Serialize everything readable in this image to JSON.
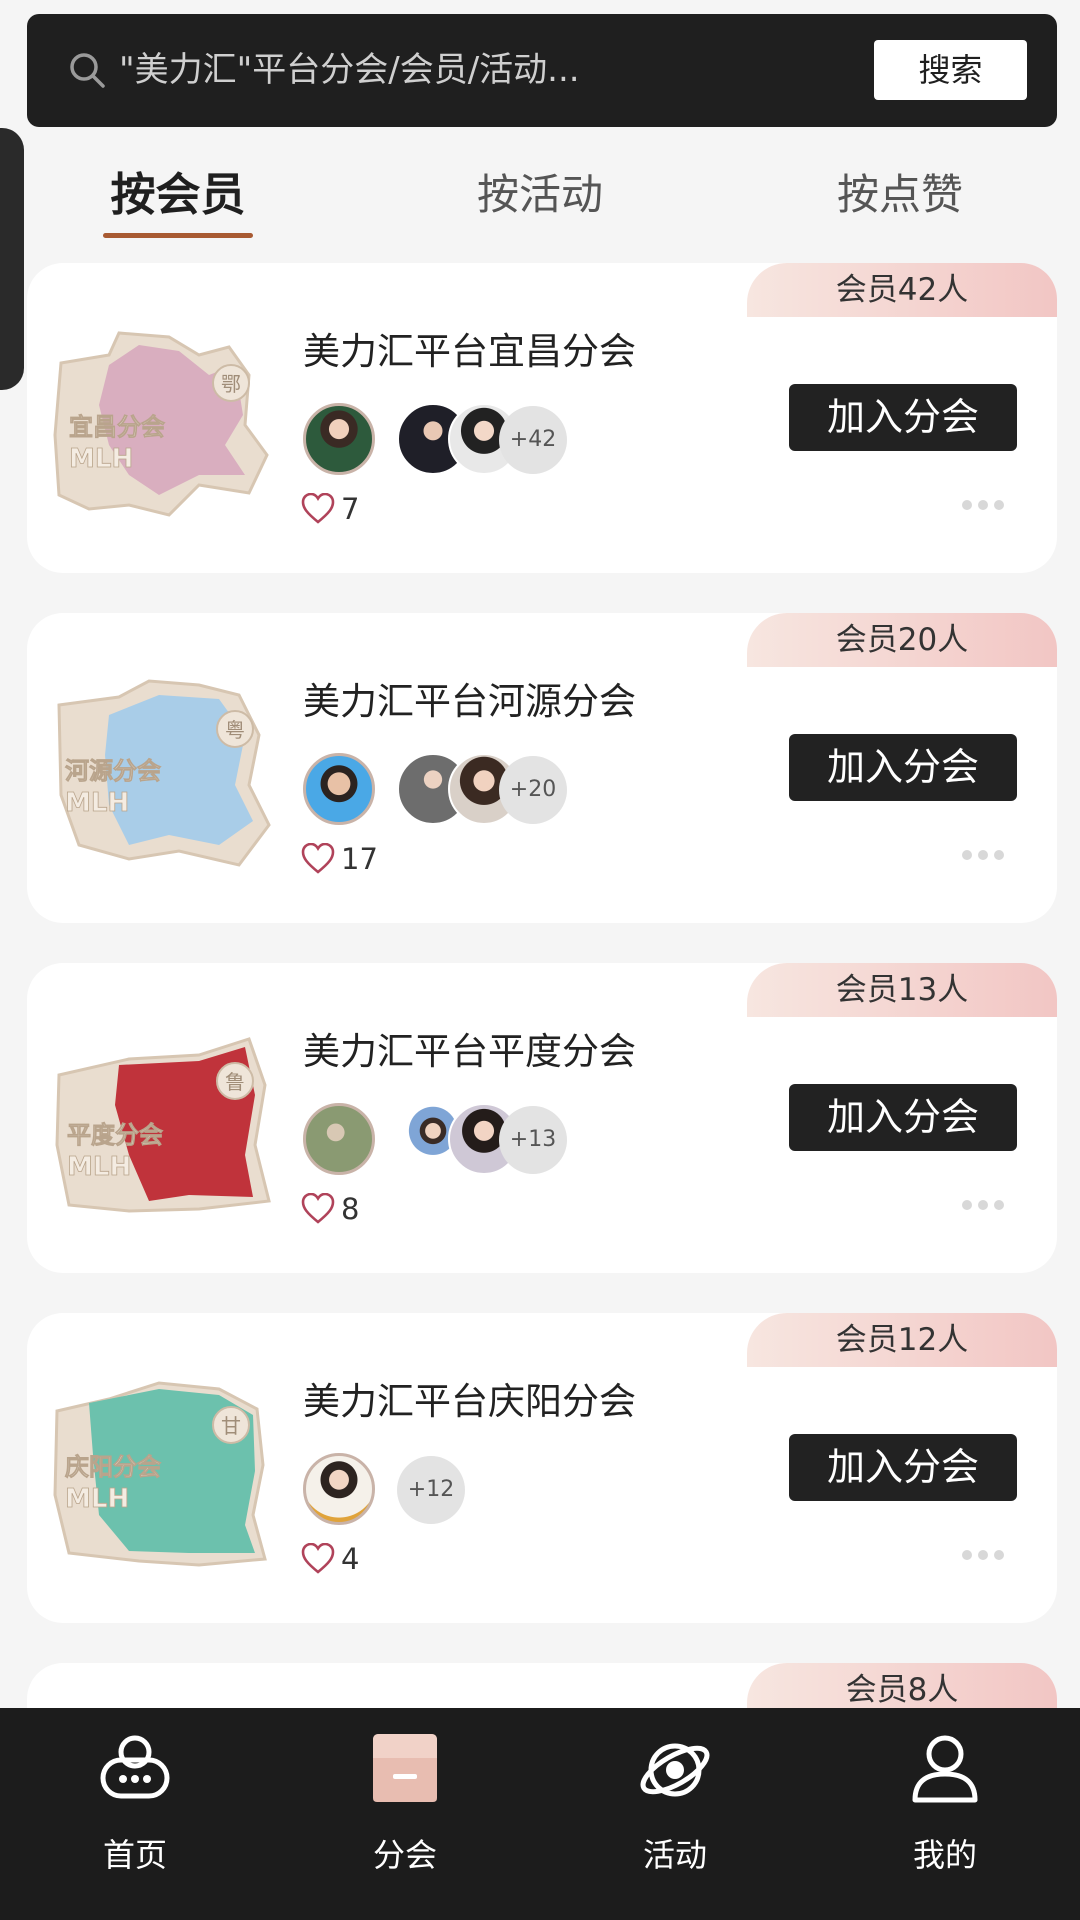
{
  "search": {
    "placeholder": "\"美力汇\"平台分会/会员/活动...",
    "button_label": "搜索"
  },
  "tabs": [
    {
      "label": "按会员",
      "active": true
    },
    {
      "label": "按活动",
      "active": false
    },
    {
      "label": "按点赞",
      "active": false
    }
  ],
  "branches": [
    {
      "name": "美力汇平台宜昌分会",
      "members_label": "会员42人",
      "badge_text": "宜昌分会",
      "badge_logo": "MLH",
      "badge_region": "鄂",
      "badge_color": "#d9aebf",
      "more_count": "+42",
      "likes": "7",
      "join_label": "加入分会"
    },
    {
      "name": "美力汇平台河源分会",
      "members_label": "会员20人",
      "badge_text": "河源分会",
      "badge_logo": "MLH",
      "badge_region": "粤",
      "badge_color": "#a9cde8",
      "more_count": "+20",
      "likes": "17",
      "join_label": "加入分会"
    },
    {
      "name": "美力汇平台平度分会",
      "members_label": "会员13人",
      "badge_text": "平度分会",
      "badge_logo": "MLH",
      "badge_region": "鲁",
      "badge_color": "#c0333b",
      "more_count": "+13",
      "likes": "8",
      "join_label": "加入分会"
    },
    {
      "name": "美力汇平台庆阳分会",
      "members_label": "会员12人",
      "badge_text": "庆阳分会",
      "badge_logo": "MLH",
      "badge_region": "甘",
      "badge_color": "#6cc1ad",
      "more_count": "+12",
      "likes": "4",
      "join_label": "加入分会"
    },
    {
      "members_label": "会员8人"
    }
  ],
  "nav": [
    {
      "label": "首页",
      "icon": "home-robot-icon"
    },
    {
      "label": "分会",
      "icon": "shop-icon",
      "active": true
    },
    {
      "label": "活动",
      "icon": "planet-icon"
    },
    {
      "label": "我的",
      "icon": "user-icon"
    }
  ],
  "colors": {
    "dark": "#1f1f1f",
    "accent_underline": "#a85a32",
    "badge_gradient_start": "#f7e6e0",
    "badge_gradient_end": "#f2c6c4"
  }
}
